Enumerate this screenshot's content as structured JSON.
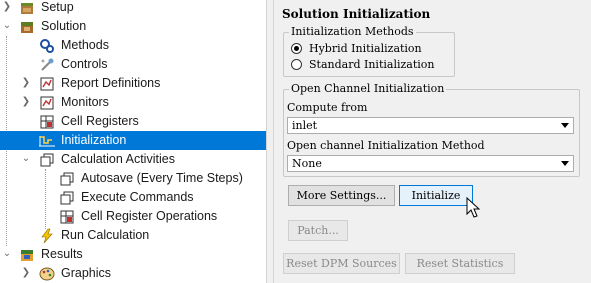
{
  "tree": {
    "setup": "Setup",
    "solution": "Solution",
    "methods": "Methods",
    "controls": "Controls",
    "report_definitions": "Report Definitions",
    "monitors": "Monitors",
    "cell_registers": "Cell Registers",
    "initialization": "Initialization",
    "calculation_activities": "Calculation Activities",
    "autosave": "Autosave (Every Time Steps)",
    "execute_commands": "Execute Commands",
    "cell_register_operations": "Cell Register Operations",
    "run_calculation": "Run Calculation",
    "results": "Results",
    "graphics": "Graphics"
  },
  "panel": {
    "title": "Solution Initialization",
    "methods_group": {
      "legend": "Initialization Methods",
      "options": [
        "Hybrid  Initialization",
        "Standard Initialization"
      ],
      "selected": "Hybrid  Initialization"
    },
    "open_channel_group": {
      "legend": "Open Channel Initialization",
      "compute_from_label": "Compute from",
      "compute_from_value": "inlet",
      "method_label": "Open channel Initialization Method",
      "method_value": "None"
    },
    "buttons": {
      "more_settings": "More Settings...",
      "initialize": "Initialize",
      "patch": "Patch...",
      "reset_dpm": "Reset DPM Sources",
      "reset_statistics": "Reset Statistics"
    }
  },
  "colors": {
    "selection": "#0078d7",
    "panel_bg": "#f0f0f0",
    "tree_bg": "#ffffff"
  }
}
